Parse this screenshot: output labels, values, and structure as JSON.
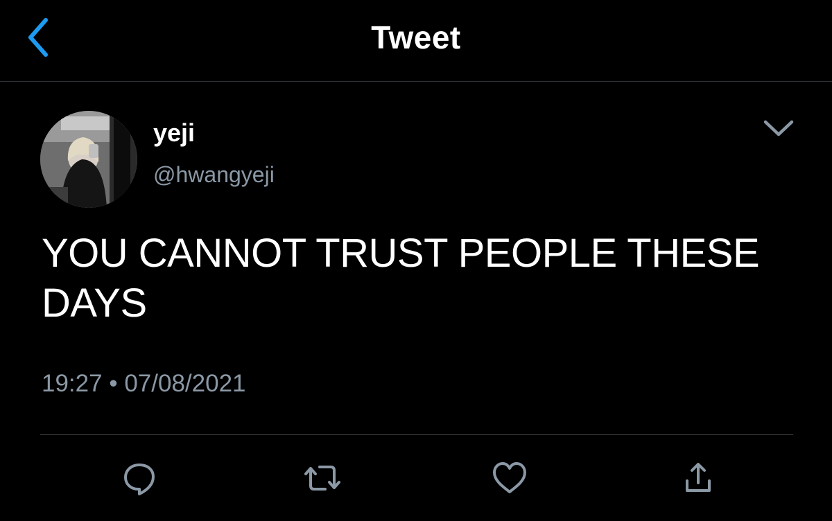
{
  "header": {
    "title": "Tweet",
    "back_icon": "chevron-left-icon",
    "accent_color": "#1d9bf0"
  },
  "tweet": {
    "author": {
      "display_name": "yeji",
      "handle": "@hwangyeji"
    },
    "text": "YOU CANNOT TRUST PEOPLE THESE DAYS",
    "time": "19:27",
    "separator": "•",
    "date": "07/08/2021",
    "menu_icon": "chevron-down-icon"
  },
  "actions": [
    {
      "name": "reply",
      "icon": "reply-icon"
    },
    {
      "name": "retweet",
      "icon": "retweet-icon"
    },
    {
      "name": "like",
      "icon": "heart-icon"
    },
    {
      "name": "share",
      "icon": "share-icon"
    }
  ],
  "colors": {
    "background": "#000000",
    "text_primary": "#ffffff",
    "text_secondary": "#8b98a5",
    "icon": "#8b98a5"
  }
}
